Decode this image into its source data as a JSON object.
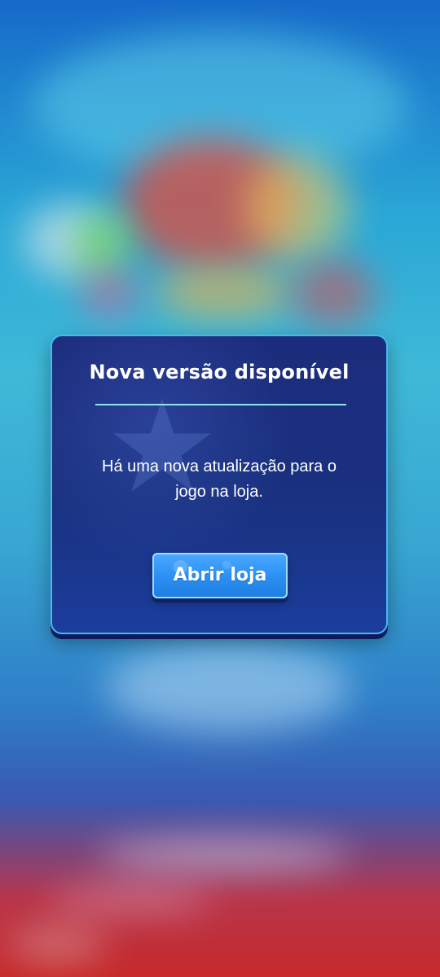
{
  "dialog": {
    "title": "Nova versão disponível",
    "message": "Há uma nova atualização para o jogo na loja.",
    "button_label": "Abrir loja"
  },
  "colors": {
    "dialog_background": "#19317f",
    "dialog_border": "#45b8f2",
    "divider": "#8fe3f7",
    "button_background": "#2a8ef2",
    "button_border": "#9fdcff",
    "text": "#ffffff"
  },
  "icons": {
    "background_decoration": "star-icon"
  }
}
